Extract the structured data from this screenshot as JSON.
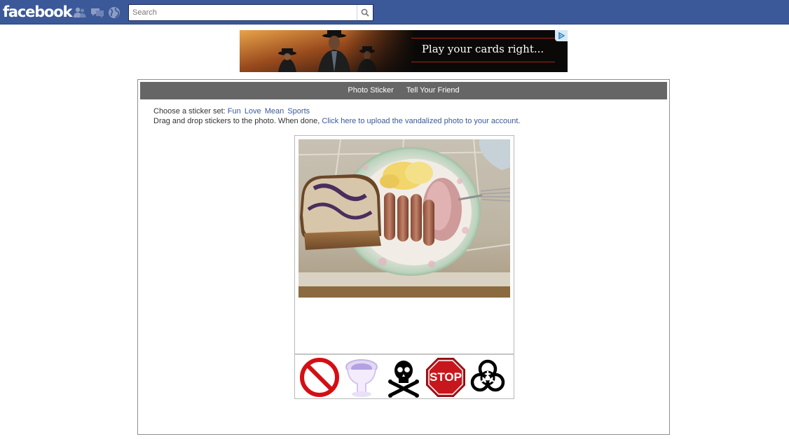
{
  "topbar": {
    "logo_text": "facebook",
    "search": {
      "placeholder": "Search",
      "value": ""
    },
    "icons": [
      "friend-requests-icon",
      "messages-icon",
      "notifications-globe-icon",
      "search-icon"
    ]
  },
  "ad": {
    "text": "Play your cards right...",
    "icon": "ad-choices-icon"
  },
  "app": {
    "nav": [
      {
        "label": "Photo Sticker"
      },
      {
        "label": "Tell Your Friend"
      }
    ],
    "instructions": {
      "choose_label": "Choose a sticker set:",
      "sets": [
        "Fun",
        "Love",
        "Mean",
        "Sports"
      ],
      "drag_text": "Drag and drop stickers to the photo. When done,",
      "upload_link": "Click here to upload the vandalized photo to your account",
      "period": "."
    },
    "photo": {
      "icon": "breakfast-photo"
    },
    "stickers": [
      {
        "name": "no-sign-sticker"
      },
      {
        "name": "toilet-sticker"
      },
      {
        "name": "skull-crossbones-sticker"
      },
      {
        "name": "stop-sign-sticker",
        "text": "STOP"
      },
      {
        "name": "biohazard-sticker"
      }
    ]
  },
  "colors": {
    "brand_blue": "#3b5998",
    "nav_gray": "#666666",
    "link_blue": "#3b5998",
    "stop_red": "#c8161d"
  }
}
